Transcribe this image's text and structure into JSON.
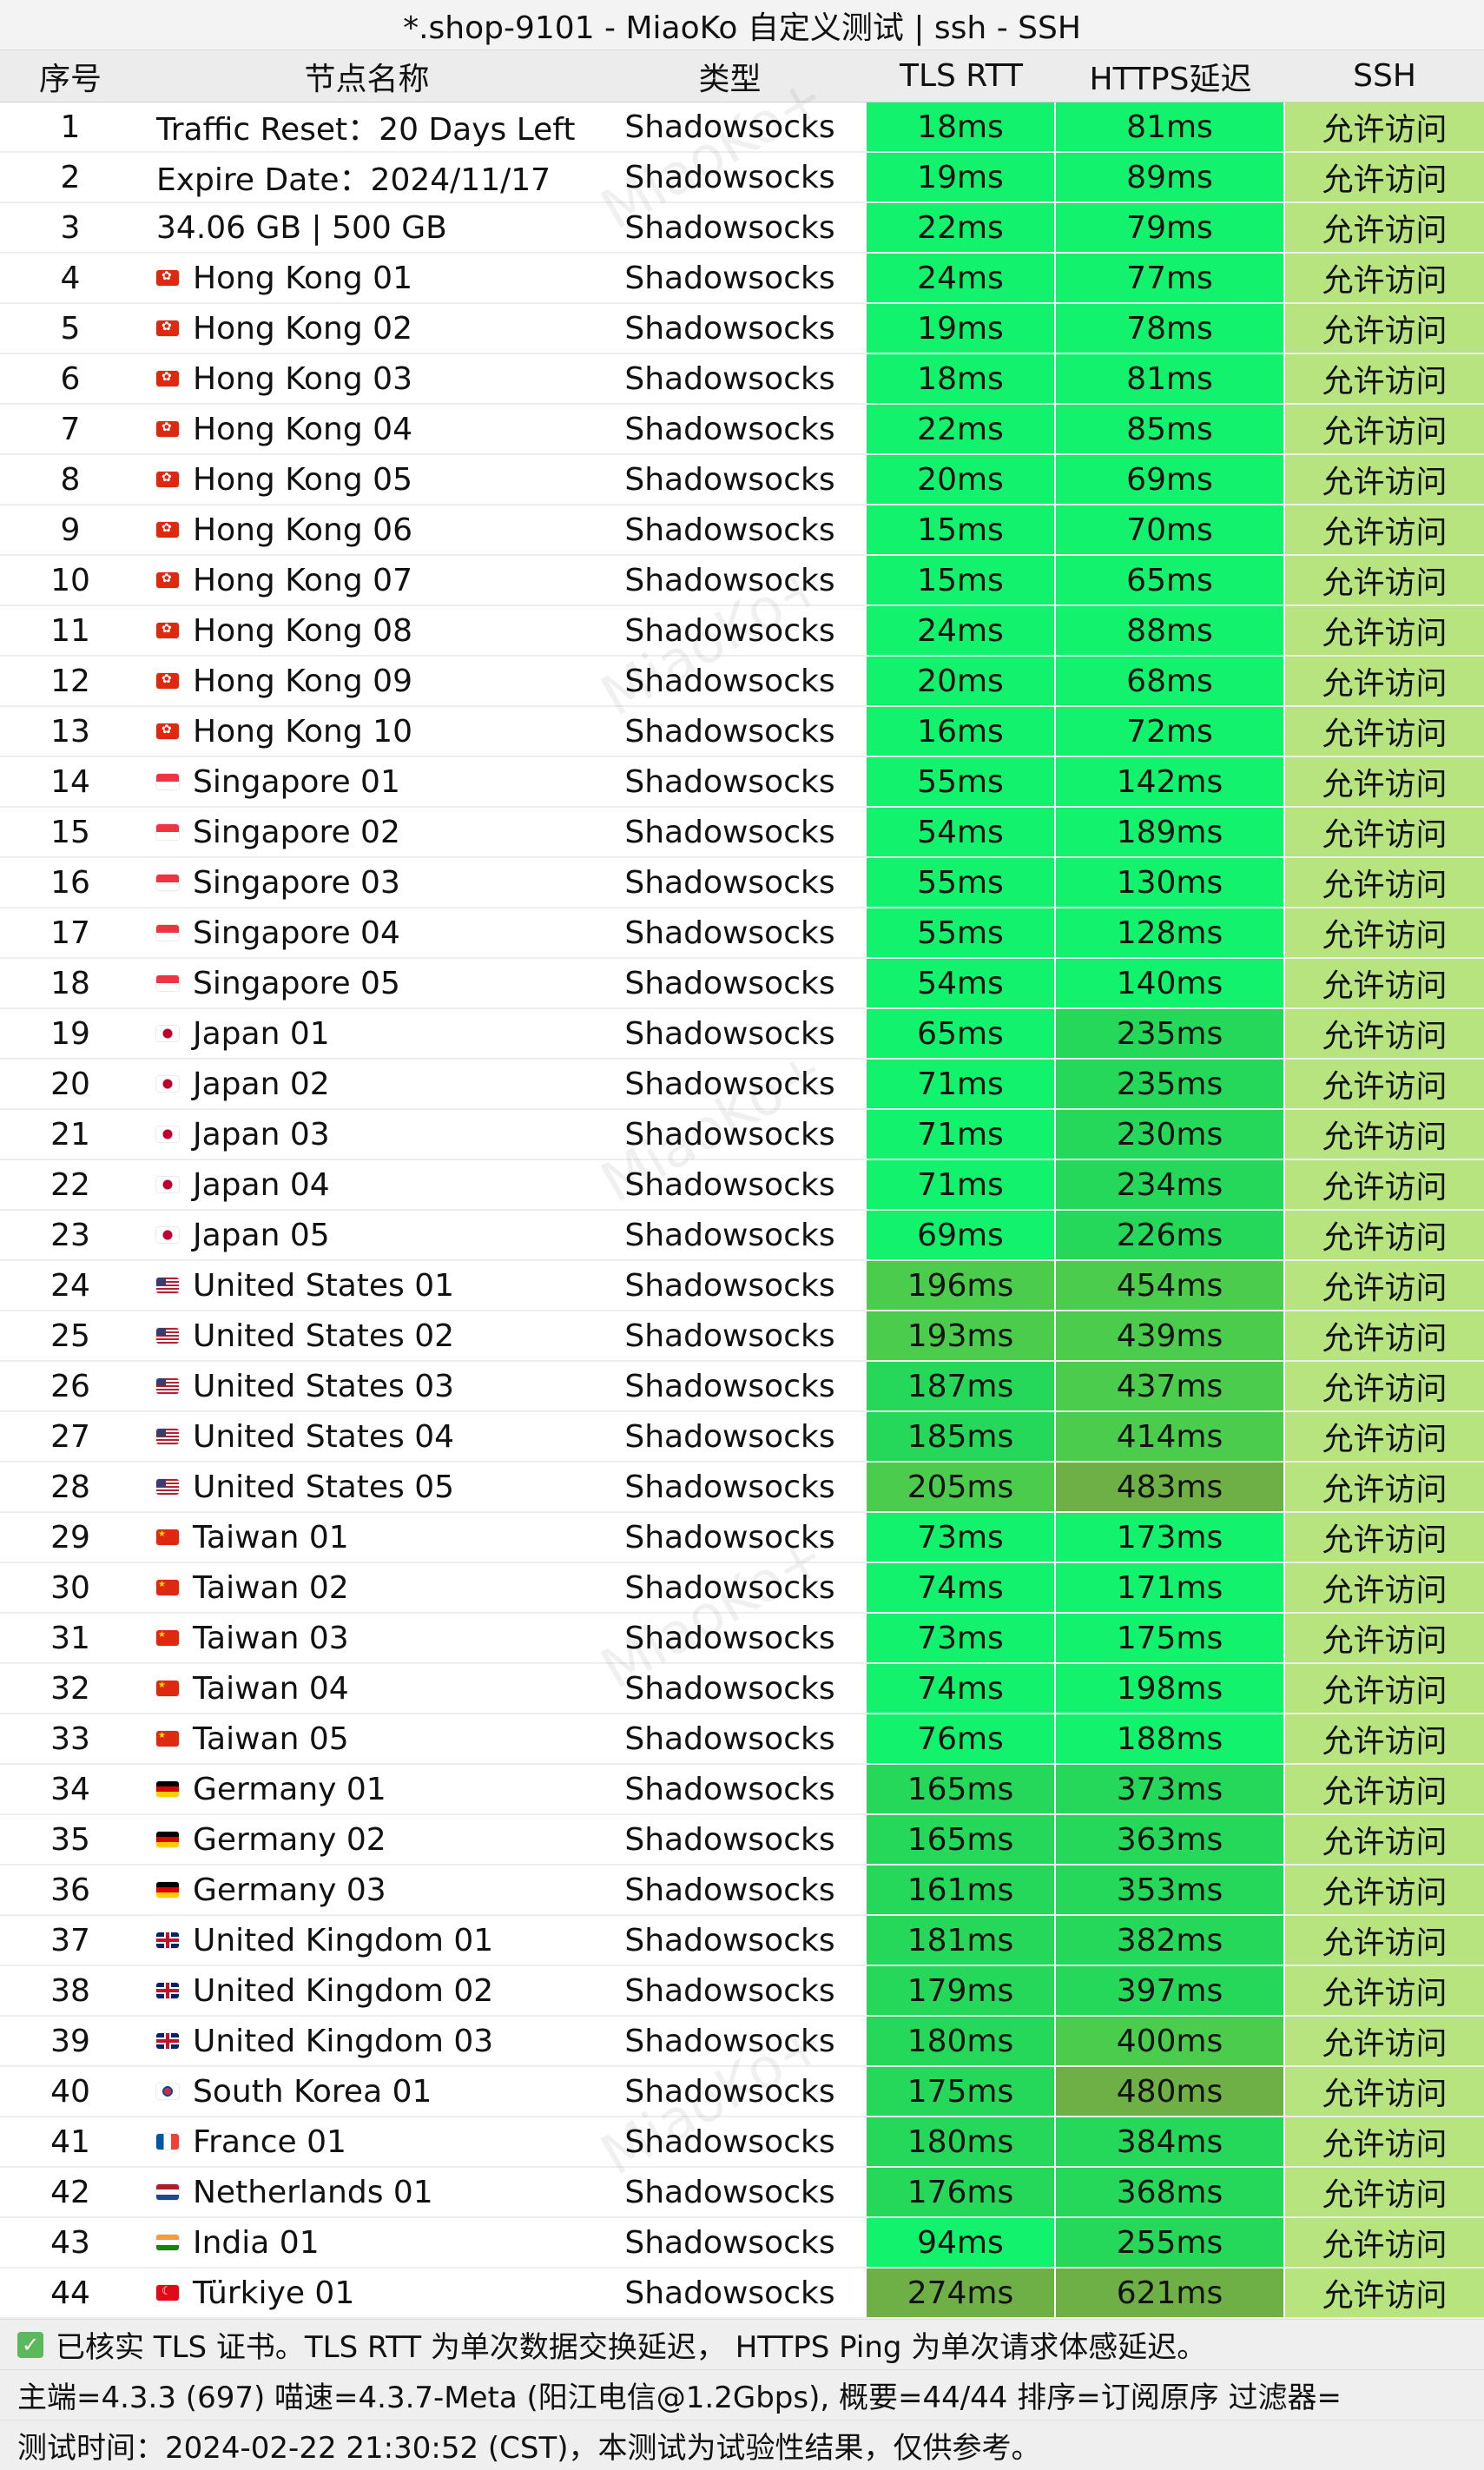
{
  "title": "*.shop-9101 - MiaoKo 自定义测试 | ssh - SSH",
  "watermark": "MiaoKo+",
  "columns": [
    "序号",
    "节点名称",
    "类型",
    "TLS RTT",
    "HTTPS延迟",
    "SSH"
  ],
  "rows": [
    {
      "idx": "1",
      "flag": "",
      "name": "Traffic Reset：20 Days Left",
      "type": "Shadowsocks",
      "tls": "18ms",
      "https": "81ms",
      "ssh": "允许访问"
    },
    {
      "idx": "2",
      "flag": "",
      "name": "Expire Date：2024/11/17",
      "type": "Shadowsocks",
      "tls": "19ms",
      "https": "89ms",
      "ssh": "允许访问"
    },
    {
      "idx": "3",
      "flag": "",
      "name": "34.06 GB | 500 GB",
      "type": "Shadowsocks",
      "tls": "22ms",
      "https": "79ms",
      "ssh": "允许访问"
    },
    {
      "idx": "4",
      "flag": "hk",
      "name": "Hong Kong 01",
      "type": "Shadowsocks",
      "tls": "24ms",
      "https": "77ms",
      "ssh": "允许访问"
    },
    {
      "idx": "5",
      "flag": "hk",
      "name": "Hong Kong 02",
      "type": "Shadowsocks",
      "tls": "19ms",
      "https": "78ms",
      "ssh": "允许访问"
    },
    {
      "idx": "6",
      "flag": "hk",
      "name": "Hong Kong 03",
      "type": "Shadowsocks",
      "tls": "18ms",
      "https": "81ms",
      "ssh": "允许访问"
    },
    {
      "idx": "7",
      "flag": "hk",
      "name": "Hong Kong 04",
      "type": "Shadowsocks",
      "tls": "22ms",
      "https": "85ms",
      "ssh": "允许访问"
    },
    {
      "idx": "8",
      "flag": "hk",
      "name": "Hong Kong 05",
      "type": "Shadowsocks",
      "tls": "20ms",
      "https": "69ms",
      "ssh": "允许访问"
    },
    {
      "idx": "9",
      "flag": "hk",
      "name": "Hong Kong 06",
      "type": "Shadowsocks",
      "tls": "15ms",
      "https": "70ms",
      "ssh": "允许访问"
    },
    {
      "idx": "10",
      "flag": "hk",
      "name": "Hong Kong 07",
      "type": "Shadowsocks",
      "tls": "15ms",
      "https": "65ms",
      "ssh": "允许访问"
    },
    {
      "idx": "11",
      "flag": "hk",
      "name": "Hong Kong 08",
      "type": "Shadowsocks",
      "tls": "24ms",
      "https": "88ms",
      "ssh": "允许访问"
    },
    {
      "idx": "12",
      "flag": "hk",
      "name": "Hong Kong 09",
      "type": "Shadowsocks",
      "tls": "20ms",
      "https": "68ms",
      "ssh": "允许访问"
    },
    {
      "idx": "13",
      "flag": "hk",
      "name": "Hong Kong 10",
      "type": "Shadowsocks",
      "tls": "16ms",
      "https": "72ms",
      "ssh": "允许访问"
    },
    {
      "idx": "14",
      "flag": "sg",
      "name": "Singapore 01",
      "type": "Shadowsocks",
      "tls": "55ms",
      "https": "142ms",
      "ssh": "允许访问"
    },
    {
      "idx": "15",
      "flag": "sg",
      "name": "Singapore 02",
      "type": "Shadowsocks",
      "tls": "54ms",
      "https": "189ms",
      "ssh": "允许访问"
    },
    {
      "idx": "16",
      "flag": "sg",
      "name": "Singapore 03",
      "type": "Shadowsocks",
      "tls": "55ms",
      "https": "130ms",
      "ssh": "允许访问"
    },
    {
      "idx": "17",
      "flag": "sg",
      "name": "Singapore 04",
      "type": "Shadowsocks",
      "tls": "55ms",
      "https": "128ms",
      "ssh": "允许访问"
    },
    {
      "idx": "18",
      "flag": "sg",
      "name": "Singapore 05",
      "type": "Shadowsocks",
      "tls": "54ms",
      "https": "140ms",
      "ssh": "允许访问"
    },
    {
      "idx": "19",
      "flag": "jp",
      "name": "Japan 01",
      "type": "Shadowsocks",
      "tls": "65ms",
      "https": "235ms",
      "ssh": "允许访问"
    },
    {
      "idx": "20",
      "flag": "jp",
      "name": "Japan 02",
      "type": "Shadowsocks",
      "tls": "71ms",
      "https": "235ms",
      "ssh": "允许访问"
    },
    {
      "idx": "21",
      "flag": "jp",
      "name": "Japan 03",
      "type": "Shadowsocks",
      "tls": "71ms",
      "https": "230ms",
      "ssh": "允许访问"
    },
    {
      "idx": "22",
      "flag": "jp",
      "name": "Japan 04",
      "type": "Shadowsocks",
      "tls": "71ms",
      "https": "234ms",
      "ssh": "允许访问"
    },
    {
      "idx": "23",
      "flag": "jp",
      "name": "Japan 05",
      "type": "Shadowsocks",
      "tls": "69ms",
      "https": "226ms",
      "ssh": "允许访问"
    },
    {
      "idx": "24",
      "flag": "us",
      "name": "United States 01",
      "type": "Shadowsocks",
      "tls": "196ms",
      "https": "454ms",
      "ssh": "允许访问"
    },
    {
      "idx": "25",
      "flag": "us",
      "name": "United States 02",
      "type": "Shadowsocks",
      "tls": "193ms",
      "https": "439ms",
      "ssh": "允许访问"
    },
    {
      "idx": "26",
      "flag": "us",
      "name": "United States 03",
      "type": "Shadowsocks",
      "tls": "187ms",
      "https": "437ms",
      "ssh": "允许访问"
    },
    {
      "idx": "27",
      "flag": "us",
      "name": "United States 04",
      "type": "Shadowsocks",
      "tls": "185ms",
      "https": "414ms",
      "ssh": "允许访问"
    },
    {
      "idx": "28",
      "flag": "us",
      "name": "United States 05",
      "type": "Shadowsocks",
      "tls": "205ms",
      "https": "483ms",
      "ssh": "允许访问"
    },
    {
      "idx": "29",
      "flag": "tw",
      "name": "Taiwan 01",
      "type": "Shadowsocks",
      "tls": "73ms",
      "https": "173ms",
      "ssh": "允许访问"
    },
    {
      "idx": "30",
      "flag": "tw",
      "name": "Taiwan 02",
      "type": "Shadowsocks",
      "tls": "74ms",
      "https": "171ms",
      "ssh": "允许访问"
    },
    {
      "idx": "31",
      "flag": "tw",
      "name": "Taiwan 03",
      "type": "Shadowsocks",
      "tls": "73ms",
      "https": "175ms",
      "ssh": "允许访问"
    },
    {
      "idx": "32",
      "flag": "tw",
      "name": "Taiwan 04",
      "type": "Shadowsocks",
      "tls": "74ms",
      "https": "198ms",
      "ssh": "允许访问"
    },
    {
      "idx": "33",
      "flag": "tw",
      "name": "Taiwan 05",
      "type": "Shadowsocks",
      "tls": "76ms",
      "https": "188ms",
      "ssh": "允许访问"
    },
    {
      "idx": "34",
      "flag": "de",
      "name": "Germany 01",
      "type": "Shadowsocks",
      "tls": "165ms",
      "https": "373ms",
      "ssh": "允许访问"
    },
    {
      "idx": "35",
      "flag": "de",
      "name": "Germany 02",
      "type": "Shadowsocks",
      "tls": "165ms",
      "https": "363ms",
      "ssh": "允许访问"
    },
    {
      "idx": "36",
      "flag": "de",
      "name": "Germany 03",
      "type": "Shadowsocks",
      "tls": "161ms",
      "https": "353ms",
      "ssh": "允许访问"
    },
    {
      "idx": "37",
      "flag": "gb",
      "name": "United Kingdom 01",
      "type": "Shadowsocks",
      "tls": "181ms",
      "https": "382ms",
      "ssh": "允许访问"
    },
    {
      "idx": "38",
      "flag": "gb",
      "name": "United Kingdom 02",
      "type": "Shadowsocks",
      "tls": "179ms",
      "https": "397ms",
      "ssh": "允许访问"
    },
    {
      "idx": "39",
      "flag": "gb",
      "name": "United Kingdom 03",
      "type": "Shadowsocks",
      "tls": "180ms",
      "https": "400ms",
      "ssh": "允许访问"
    },
    {
      "idx": "40",
      "flag": "kr",
      "name": "South Korea 01",
      "type": "Shadowsocks",
      "tls": "175ms",
      "https": "480ms",
      "ssh": "允许访问"
    },
    {
      "idx": "41",
      "flag": "fr",
      "name": "France 01",
      "type": "Shadowsocks",
      "tls": "180ms",
      "https": "384ms",
      "ssh": "允许访问"
    },
    {
      "idx": "42",
      "flag": "nl",
      "name": "Netherlands 01",
      "type": "Shadowsocks",
      "tls": "176ms",
      "https": "368ms",
      "ssh": "允许访问"
    },
    {
      "idx": "43",
      "flag": "in",
      "name": "India 01",
      "type": "Shadowsocks",
      "tls": "94ms",
      "https": "255ms",
      "ssh": "允许访问"
    },
    {
      "idx": "44",
      "flag": "tr",
      "name": "Türkiye 01",
      "type": "Shadowsocks",
      "tls": "274ms",
      "https": "621ms",
      "ssh": "允许访问"
    }
  ],
  "footer": {
    "check_icon": "check-icon",
    "note": "已核实 TLS 证书。TLS RTT 为单次数据交换延迟， HTTPS Ping 为单次请求体感延迟。",
    "info": "主端=4.3.3 (697) 喵速=4.3.7-Meta (阳江电信@1.2Gbps), 概要=44/44 排序=订阅原序 过滤器=",
    "time": "测试时间：2024-02-22 21:30:52 (CST)，本测试为试验性结果，仅供参考。"
  },
  "colors": {
    "latency_fast": "#13f26d",
    "latency_medium": "#26d859",
    "latency_slow": "#4ccc4c",
    "latency_slowest": "#6eb045",
    "ssh_cell": "#b7e47f",
    "check": "#5cb85c"
  }
}
